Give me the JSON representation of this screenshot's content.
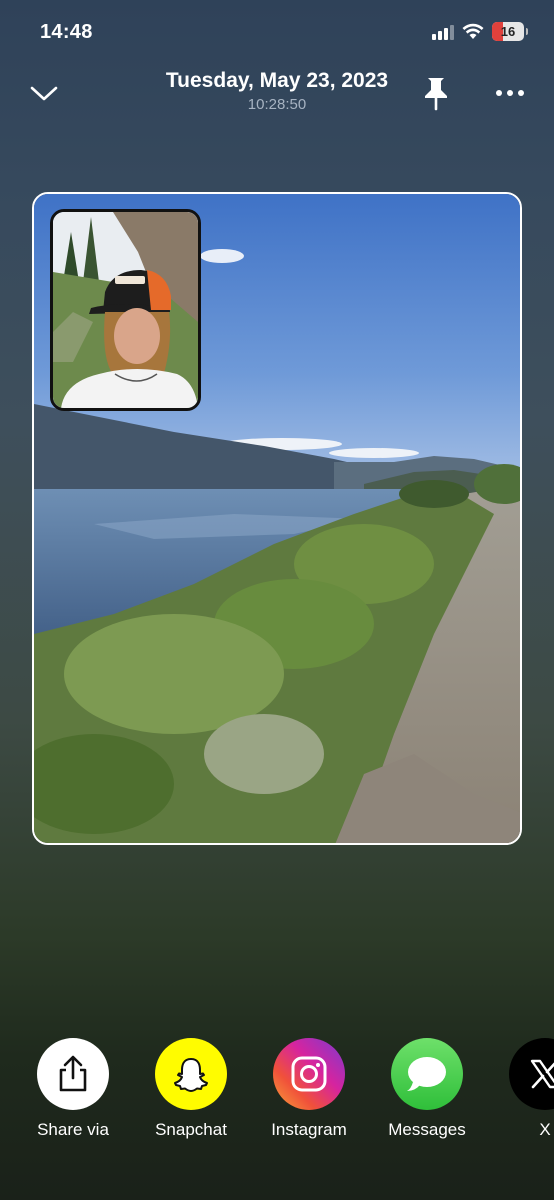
{
  "status_bar": {
    "time": "14:48",
    "battery_level": "16",
    "battery_color": "#e0413c"
  },
  "header": {
    "date": "Tuesday, May 23, 2023",
    "time": "10:28:50",
    "icons": {
      "back": "chevron-down-icon",
      "pin": "pin-icon",
      "more": "more-icon"
    }
  },
  "memory": {
    "main_photo": "lake-trail-landscape",
    "selfie_photo": "front-camera-selfie"
  },
  "share": {
    "items": [
      {
        "label": "Share via",
        "icon": "share-icon",
        "color": "#ffffff"
      },
      {
        "label": "Snapchat",
        "icon": "snapchat-icon",
        "color": "#fffc00"
      },
      {
        "label": "Instagram",
        "icon": "instagram-icon",
        "color": "#d6249f"
      },
      {
        "label": "Messages",
        "icon": "messages-icon",
        "color": "#4cd964"
      },
      {
        "label": "X",
        "icon": "x-icon",
        "color": "#000000"
      }
    ]
  }
}
